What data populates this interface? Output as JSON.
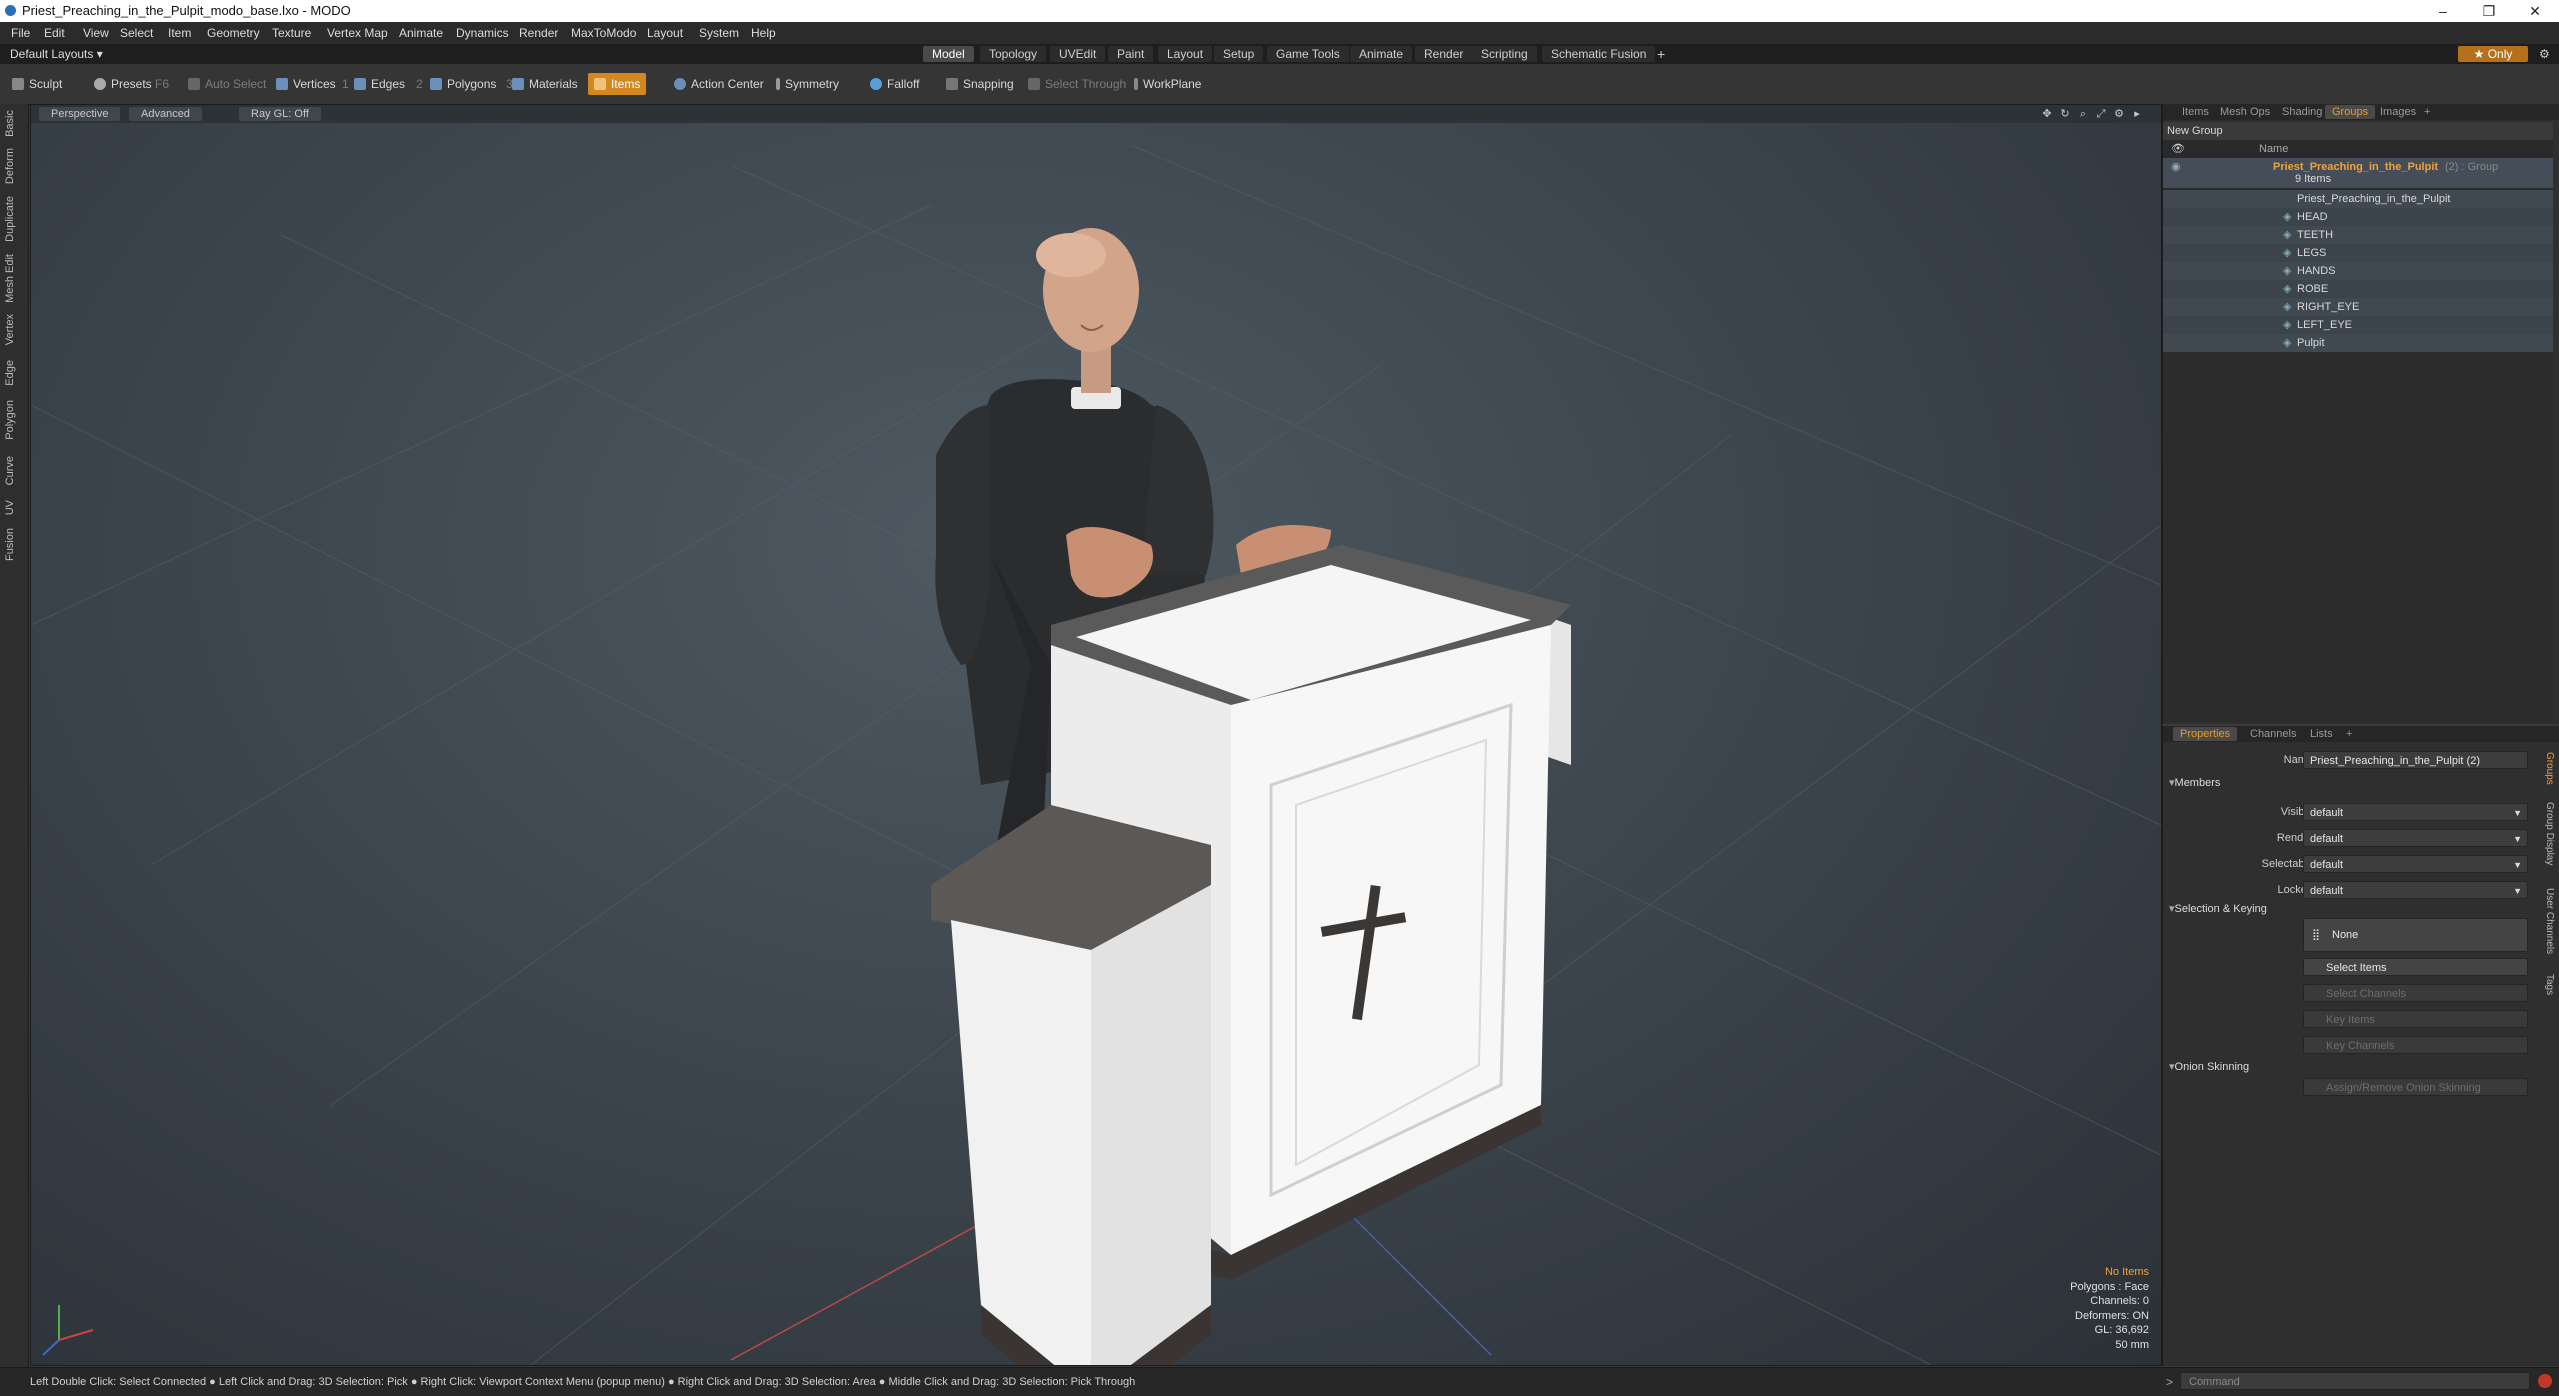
{
  "window": {
    "title": "Priest_Preaching_in_the_Pulpit_modo_base.lxo - MODO",
    "minimize": "–",
    "maximize": "❐",
    "close": "✕"
  },
  "menu": [
    "File",
    "Edit",
    "View",
    "Select",
    "Item",
    "Geometry",
    "Texture",
    "Vertex Map",
    "Animate",
    "Dynamics",
    "Render",
    "MaxToModo",
    "Layout",
    "System",
    "Help"
  ],
  "layout_bar": {
    "layouts_label": "Default Layouts ▾",
    "tabs": [
      "Model",
      "Topology",
      "UVEdit",
      "Paint",
      "Layout",
      "Setup",
      "Game Tools",
      "Animate",
      "Render",
      "Scripting",
      "Schematic Fusion"
    ],
    "active_tab": "Model",
    "add_label": "+",
    "only_label": "★ Only"
  },
  "toolbar": {
    "sculpt": "Sculpt",
    "presets": "Presets",
    "presets_key": "F6",
    "auto_select": "Auto Select",
    "vertices": "Vertices",
    "edges": "Edges",
    "polygons": "Polygons",
    "materials": "Materials",
    "items": "Items",
    "action_center": "Action Center",
    "symmetry": "Symmetry",
    "falloff": "Falloff",
    "snapping": "Snapping",
    "select_through": "Select Through",
    "workplane": "WorkPlane",
    "num1": "1",
    "num2": "2",
    "num3": "3"
  },
  "left_tabs": [
    "Basic",
    "Deform",
    "Duplicate",
    "Mesh Edit",
    "Vertex",
    "Edge",
    "Polygon",
    "Curve",
    "UV",
    "Fusion"
  ],
  "viewport": {
    "view_mode": "Perspective",
    "shading": "Advanced",
    "raygl": "Ray GL: Off",
    "info": {
      "selection": "No Items",
      "polygons": "Polygons : Face",
      "channels": "Channels: 0",
      "deformers": "Deformers: ON",
      "gl": "GL: 36,692",
      "scale": "50 mm"
    }
  },
  "groups_panel": {
    "tabs": [
      "Items",
      "Mesh Ops",
      "Shading",
      "Groups",
      "Images",
      "+"
    ],
    "active_tab": "Groups",
    "new_group": "New Group",
    "col_name": "Name",
    "group_name": "Priest_Preaching_in_the_Pulpit",
    "group_suffix": "(2) : Group",
    "group_count": "9 Items",
    "items": [
      "Priest_Preaching_in_the_Pulpit",
      "HEAD",
      "TEETH",
      "LEGS",
      "HANDS",
      "ROBE",
      "RIGHT_EYE",
      "LEFT_EYE",
      "Pulpit"
    ]
  },
  "properties_panel": {
    "tabs": [
      "Properties",
      "Channels",
      "Lists",
      "+"
    ],
    "active_tab": "Properties",
    "name_label": "Name",
    "name_value": "Priest_Preaching_in_the_Pulpit (2)",
    "members_section": "Members",
    "fields": [
      {
        "label": "Visible",
        "value": "default"
      },
      {
        "label": "Render",
        "value": "default"
      },
      {
        "label": "Selectable",
        "value": "default"
      },
      {
        "label": "Locked",
        "value": "default"
      }
    ],
    "selection_section": "Selection & Keying",
    "none_button": "None",
    "select_items": "Select Items",
    "select_channels": "Select Channels",
    "key_items": "Key Items",
    "key_channels": "Key Channels",
    "onion_section": "Onion Skinning",
    "onion_button": "Assign/Remove Onion Skinning",
    "side_tabs": [
      "Groups",
      "Group Display",
      "User Channels",
      "Tags"
    ]
  },
  "statusbar": {
    "text": "Left Double Click: Select Connected ● Left Click and Drag: 3D Selection: Pick ● Right Click: Viewport Context Menu (popup menu) ● Right Click and Drag: 3D Selection: Area ● Middle Click and Drag: 3D Selection: Pick Through",
    "command_placeholder": "Command"
  },
  "colors": {
    "accent": "#d3871f",
    "panel_bg": "#2f2f2f",
    "viewport_bg": "#3a424a"
  }
}
